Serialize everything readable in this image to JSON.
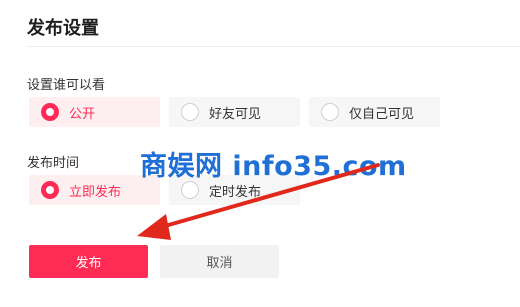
{
  "header": {
    "title": "发布设置"
  },
  "visibility": {
    "label": "设置谁可以看",
    "options": [
      {
        "label": "公开",
        "selected": true
      },
      {
        "label": "好友可见",
        "selected": false
      },
      {
        "label": "仅自己可见",
        "selected": false
      }
    ]
  },
  "publish_time": {
    "label": "发布时间",
    "options": [
      {
        "label": "立即发布",
        "selected": true
      },
      {
        "label": "定时发布",
        "selected": false
      }
    ]
  },
  "actions": {
    "publish_label": "发布",
    "cancel_label": "取消"
  },
  "watermark": {
    "text": "商娱网 info35.com"
  },
  "colors": {
    "accent": "#fe2c55",
    "watermark": "#1f6fd6",
    "arrow": "#e0281d"
  }
}
